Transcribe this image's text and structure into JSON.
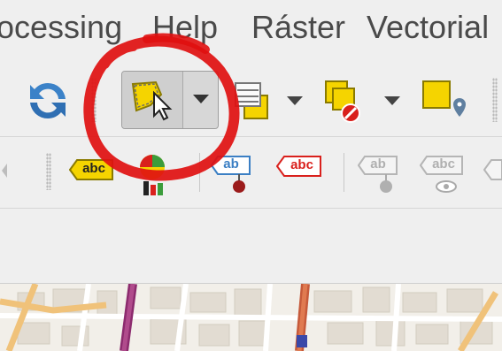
{
  "menu": {
    "items": [
      {
        "label": "ocessing"
      },
      {
        "label": "Help"
      },
      {
        "label": "Ráster"
      },
      {
        "label": "Vectorial"
      }
    ]
  },
  "toolbar": {
    "refresh_icon": "refresh-icon",
    "select_features_icon": "select-features-by-area-icon",
    "dropdown_icon": "chevron-down-icon",
    "attribute_table_icon": "attribute-table-icon",
    "deselect_icon": "deselect-features-icon",
    "select_location_icon": "select-by-location-icon"
  },
  "label_toolbar": {
    "tag1": "abc",
    "tag2": "ab",
    "tag3": "abc",
    "tag4": "ab",
    "tag5": "abc"
  },
  "colors": {
    "annotation": "#e01010",
    "accent_yellow": "#f5d400",
    "label_blue": "#3b7fc4",
    "label_red": "#d9201c"
  }
}
